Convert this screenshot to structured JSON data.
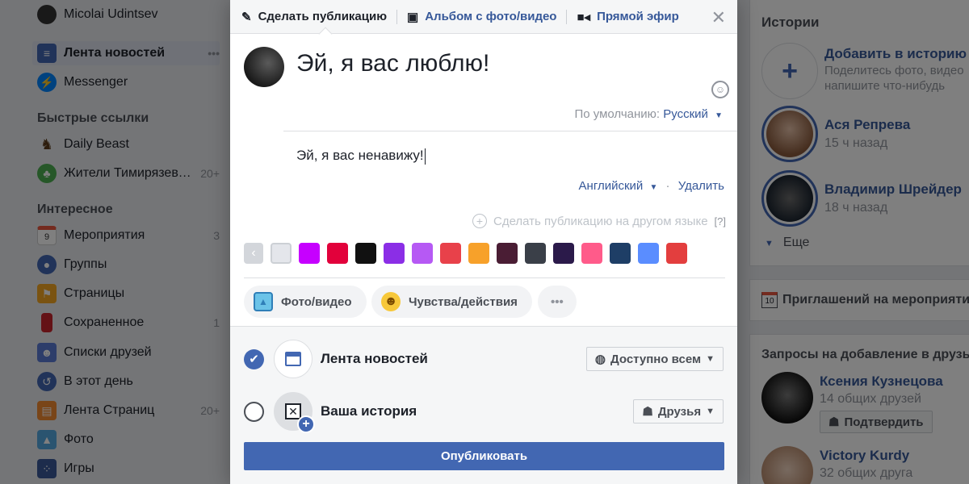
{
  "sidebar": {
    "user_name": "Micolai Udintsev",
    "items": [
      {
        "label": "Лента новостей",
        "more": "•••"
      },
      {
        "label": "Messenger"
      }
    ],
    "shortcuts_title": "Быстрые ссылки",
    "shortcuts": [
      {
        "label": "Daily Beast"
      },
      {
        "label": "Жители Тимирязевского",
        "count": "20+"
      }
    ],
    "explore_title": "Интересное",
    "explore": [
      {
        "label": "Мероприятия",
        "count": "3",
        "icon_text": "9"
      },
      {
        "label": "Группы"
      },
      {
        "label": "Страницы"
      },
      {
        "label": "Сохраненное",
        "count": "1"
      },
      {
        "label": "Списки друзей"
      },
      {
        "label": "В этот день"
      },
      {
        "label": "Лента Страниц",
        "count": "20+"
      },
      {
        "label": "Фото"
      },
      {
        "label": "Игры"
      }
    ]
  },
  "right": {
    "stories_title": "Истории",
    "add_story_title": "Добавить в историю",
    "add_story_sub1": "Поделитесь фото, видео",
    "add_story_sub2": "напишите что-нибудь",
    "stories": [
      {
        "name": "Ася Репрева",
        "time": "15 ч назад"
      },
      {
        "name": "Владимир Шрейдер",
        "time": "18 ч назад"
      }
    ],
    "more_label": "Еще",
    "events_label": "Приглашений на мероприятия",
    "events_icon_text": "10",
    "requests_title": "Запросы на добавление в друзья",
    "requests": [
      {
        "name": "Ксения Кузнецова",
        "mutual": "14 общих друзей",
        "confirm": "Подтвердить"
      },
      {
        "name": "Victory Kurdy",
        "mutual": "32 общих друга"
      }
    ]
  },
  "composer": {
    "tabs": [
      {
        "label": "Сделать публикацию"
      },
      {
        "label": "Альбом с фото/видео"
      },
      {
        "label": "Прямой эфир"
      }
    ],
    "close": "✕",
    "post_text": "Эй, я вас люблю!",
    "default_lang_prefix": "По умолчанию:",
    "default_lang": "Русский",
    "translation_text": "Эй, я вас ненавижу!",
    "translation_lang": "Английский",
    "remove_label": "Удалить",
    "other_lang_label": "Сделать публикацию на другом языке",
    "help_label": "[?]",
    "colors": [
      "#e4e6eb",
      "#c600ff",
      "#e2013b",
      "#111111",
      "#8b2ee6",
      "#b659f4",
      "#e8414a",
      "#f7a12a",
      "#4a1d34",
      "#3a3f48",
      "#2b1a4a",
      "#ff5b8a",
      "#1e3e66",
      "#5a8dff",
      "#e33e3e"
    ],
    "photo_label": "Фото/видео",
    "feeling_label": "Чувства/действия",
    "more_label": "•••",
    "destinations": [
      {
        "label": "Лента новостей",
        "audience": "Доступно всем",
        "checked": true
      },
      {
        "label": "Ваша история",
        "audience": "Друзья",
        "checked": false
      }
    ],
    "publish_label": "Опубликовать"
  }
}
